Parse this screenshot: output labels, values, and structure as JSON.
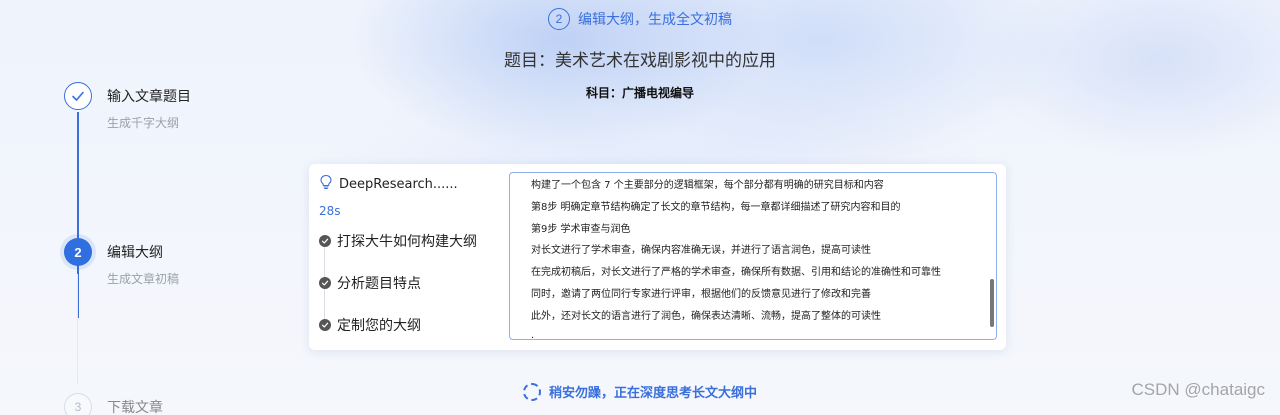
{
  "header": {
    "step_number": "2",
    "step_label": "编辑大纲，生成全文初稿",
    "title": "题目：美术艺术在戏剧影视中的应用",
    "subject": "科目：广播电视编导"
  },
  "stepper": {
    "steps": [
      {
        "number": "",
        "title": "输入文章题目",
        "subtitle": "生成千字大纲",
        "state": "done"
      },
      {
        "number": "2",
        "title": "编辑大纲",
        "subtitle": "生成文章初稿",
        "state": "active"
      },
      {
        "number": "3",
        "title": "下载文章",
        "subtitle": "",
        "state": "pending"
      }
    ]
  },
  "research": {
    "label": "DeepResearch......",
    "elapsed": "28s",
    "tasks": [
      "打探大牛如何构建大纲",
      "分析题目特点",
      "定制您的大纲"
    ]
  },
  "outline": {
    "lines": [
      "构建了一个包含 7 个主要部分的逻辑框架，每个部分都有明确的研究目标和内容",
      "第8步 明确定章节结构确定了长文的章节结构，每一章都详细描述了研究内容和目的",
      "第9步 学术审查与润色",
      "对长文进行了学术审查，确保内容准确无误，并进行了语言润色，提高可读性",
      "在完成初稿后，对长文进行了严格的学术审查，确保所有数据、引用和结论的准确性和可靠性",
      "同时，邀请了两位同行专家进行评审，根据他们的反馈意见进行了修改和完善",
      "此外，还对长文的语言进行了润色，确保表达清晰、流畅，提高了整体的可读性",
      "·"
    ]
  },
  "loading": {
    "text": "稍安勿躁，正在深度思考长文大纲中"
  },
  "watermark": "CSDN @chataigc",
  "colors": {
    "accent": "#3a6fdc",
    "active_step": "#2f6fe0"
  },
  "icons": {
    "lightbulb": "lightbulb-icon",
    "check": "check-icon",
    "spinner": "loading-spinner-icon"
  }
}
